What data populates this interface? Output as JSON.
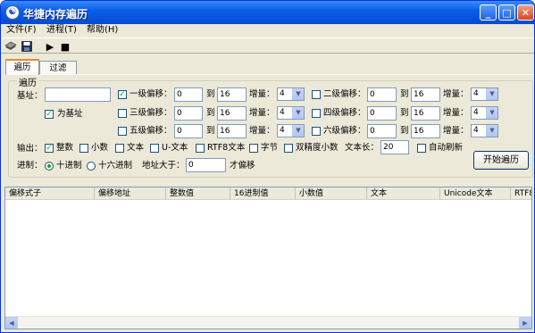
{
  "window": {
    "title": "华捷内存遍历",
    "title_icon": "app-logo-icon",
    "buttons": {
      "minimize": "_",
      "maximize": "□",
      "close": "✕"
    }
  },
  "menu": [
    {
      "label": "文件(F)"
    },
    {
      "label": "进程(T)"
    },
    {
      "label": "帮助(H)"
    }
  ],
  "toolbar": {
    "icons": [
      "open-process-icon",
      "save-icon",
      "play-icon",
      "stop-icon"
    ],
    "play_glyph": "▶",
    "stop_glyph": "■"
  },
  "tabs": [
    {
      "label": "遍历",
      "active": true
    },
    {
      "label": "过滤",
      "active": false
    }
  ],
  "search_group": {
    "legend": "遍历",
    "base_label": "基址：",
    "base_value": "",
    "is_base_label": "为基址",
    "is_base_checked": true,
    "to_label": "到",
    "step_label": "增量：",
    "offset_levels": [
      {
        "label": "一级偏移：",
        "checked": true,
        "from": "0",
        "to": "16",
        "step": "4"
      },
      {
        "label": "二级偏移：",
        "checked": false,
        "from": "0",
        "to": "16",
        "step": "4"
      },
      {
        "label": "三级偏移：",
        "checked": false,
        "from": "0",
        "to": "16",
        "step": "4"
      },
      {
        "label": "四级偏移：",
        "checked": false,
        "from": "0",
        "to": "16",
        "step": "4"
      },
      {
        "label": "五级偏移：",
        "checked": false,
        "from": "0",
        "to": "16",
        "step": "4"
      },
      {
        "label": "六级偏移：",
        "checked": false,
        "from": "0",
        "to": "16",
        "step": "4"
      }
    ],
    "output_label": "输出：",
    "output_options": [
      {
        "label": "整数",
        "checked": true
      },
      {
        "label": "小数",
        "checked": false
      },
      {
        "label": "文本",
        "checked": false
      },
      {
        "label": "U-文本",
        "checked": false
      },
      {
        "label": "RTF8文本",
        "checked": false
      },
      {
        "label": "字节",
        "checked": false
      },
      {
        "label": "双精度小数",
        "checked": false
      }
    ],
    "text_len_label": "文本长：",
    "text_len_value": "20",
    "auto_refresh_label": "自动刷新",
    "auto_refresh_checked": false,
    "radix_label": "进制：",
    "radix_options": [
      {
        "label": "十进制",
        "selected": true
      },
      {
        "label": "十六进制",
        "selected": false
      }
    ],
    "addr_gt_label": "地址大于：",
    "addr_gt_value": "0",
    "addr_gt_suffix": "才偏移",
    "start_button": "开始遍历"
  },
  "results_table": {
    "columns": [
      "偏移式子",
      "偏移地址",
      "整数值",
      "16进制值",
      "小数值",
      "文本",
      "Unicode文本",
      "RTF8"
    ],
    "rows": [],
    "scroll_left_glyph": "◀",
    "scroll_right_glyph": "▶"
  }
}
